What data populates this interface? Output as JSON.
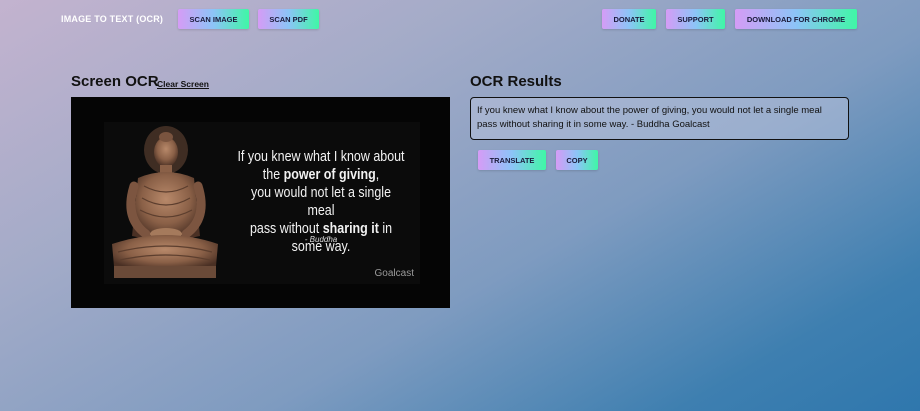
{
  "header": {
    "brand": "IMAGE TO TEXT (OCR)",
    "nav": {
      "scan_image": "SCAN IMAGE",
      "scan_pdf": "SCAN PDF",
      "donate": "DONATE",
      "support": "SUPPORT",
      "download": "DOWNLOAD FOR CHROME"
    }
  },
  "screen_ocr": {
    "title": "Screen OCR",
    "clear_link": "Clear Screen",
    "image": {
      "quote_line1": "If you knew what I know about",
      "quote_line2_pre": "the ",
      "quote_line2_bold": "power of giving",
      "quote_line2_post": ",",
      "quote_line3": "you would not let a single meal",
      "quote_line4_pre": "pass without ",
      "quote_line4_bold": "sharing it",
      "quote_line4_post": " in some way.",
      "author": "- Buddha",
      "watermark": "Goalcast"
    }
  },
  "results": {
    "title": "OCR Results",
    "text": "If you knew what I know about the power of giving, you would not let a single meal pass without sharing it in some way. - Buddha Goalcast",
    "translate_label": "TRANSLATE",
    "copy_label": "COPY"
  },
  "colors": {
    "button_gradient": [
      "#d59cf6",
      "#8cc4f7",
      "#3ff7a6"
    ],
    "background_start": "#c3b3cf",
    "background_end": "#2f77ad"
  }
}
